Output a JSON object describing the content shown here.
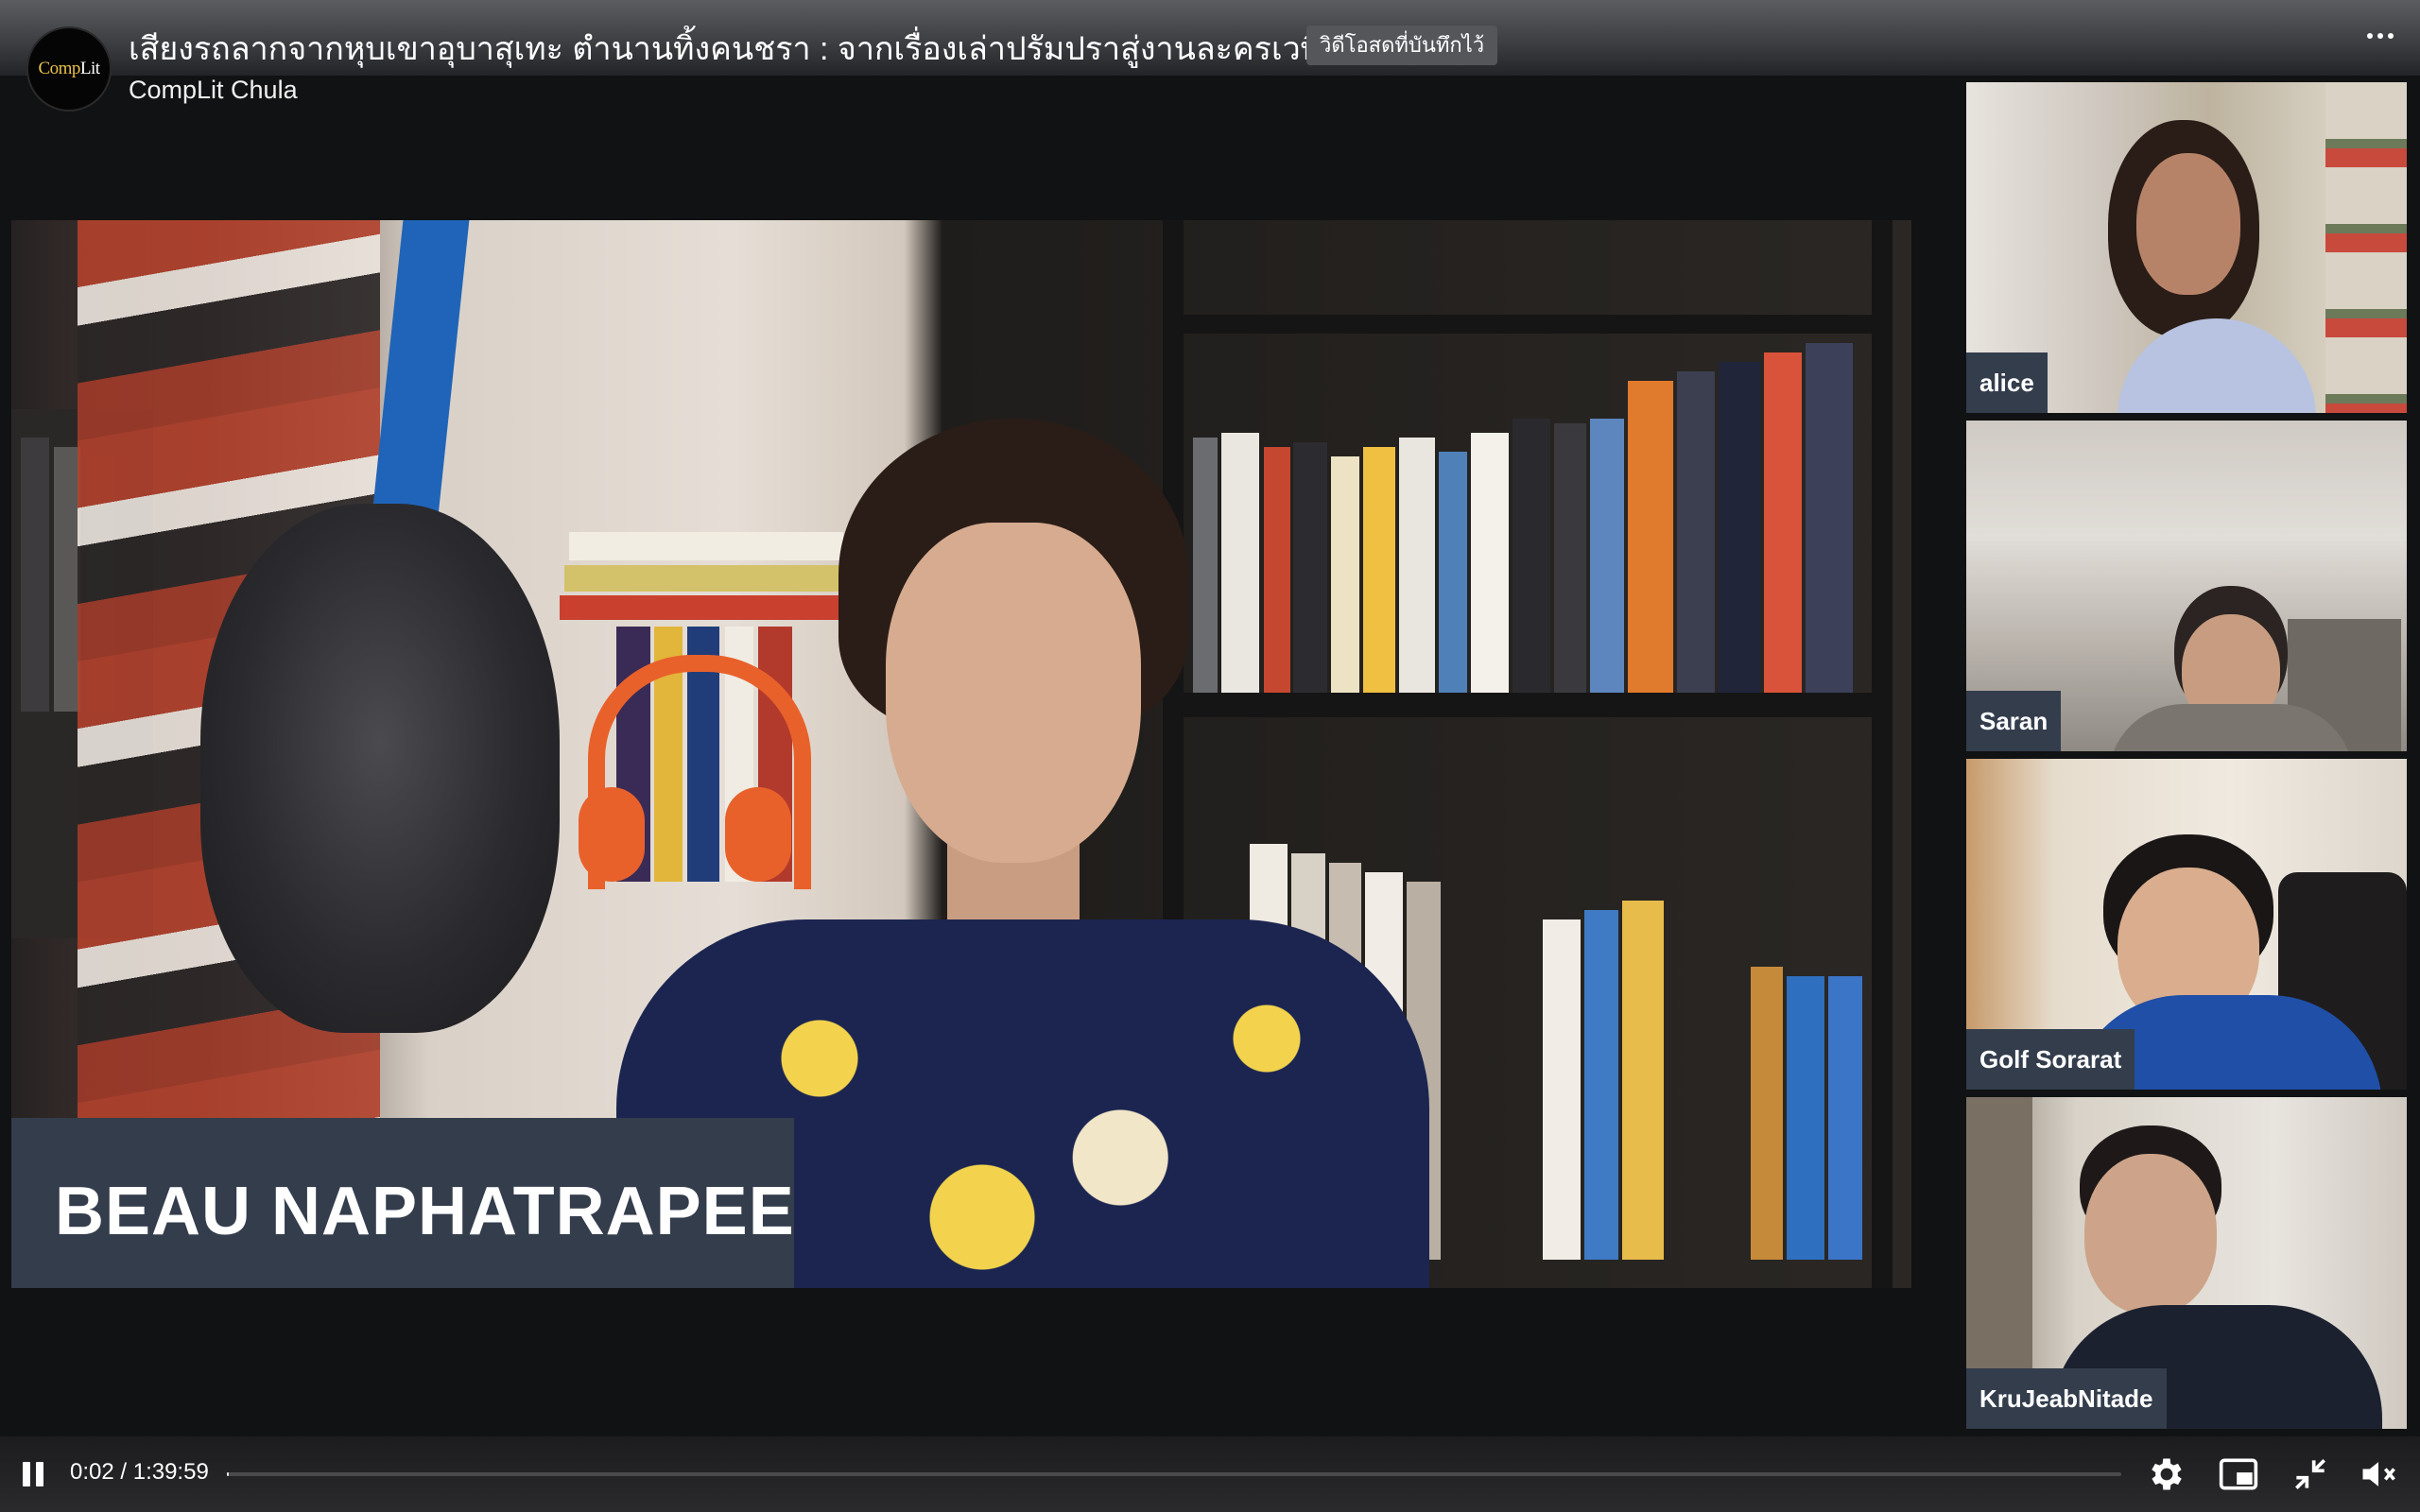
{
  "header": {
    "title": "เสียงรถลากจากหุบเขาอุบาสุเทะ ตำนานทิ้งคนชรา : จากเรื่องเล่าปรัมปราสู่งานละครเวที",
    "badge": "วิดีโอสดที่บันทึกไว้",
    "channel_name": "CompLit Chula",
    "avatar_text_a": "Comp",
    "avatar_text_b": "Lit",
    "more_icon": "more-horizontal-icon"
  },
  "main_video": {
    "speaker_name": "BEAU NAPHATRAPEE"
  },
  "participants": [
    {
      "name": "alice"
    },
    {
      "name": "Saran"
    },
    {
      "name": "Golf Sorarat"
    },
    {
      "name": "KruJeabNitade"
    }
  ],
  "controls": {
    "timecode": "0:02 / 1:39:59",
    "progress_fraction": 0.0003,
    "icons": [
      "pause-icon",
      "settings-gear-icon",
      "picture-in-picture-icon",
      "exit-fullscreen-icon",
      "muted-speaker-icon"
    ]
  },
  "colors": {
    "name_plate": "#333d4c",
    "header_bg": "#3a3c40",
    "controls_bg": "#1c1c1e",
    "accent_yellow": "#e8c24a"
  }
}
